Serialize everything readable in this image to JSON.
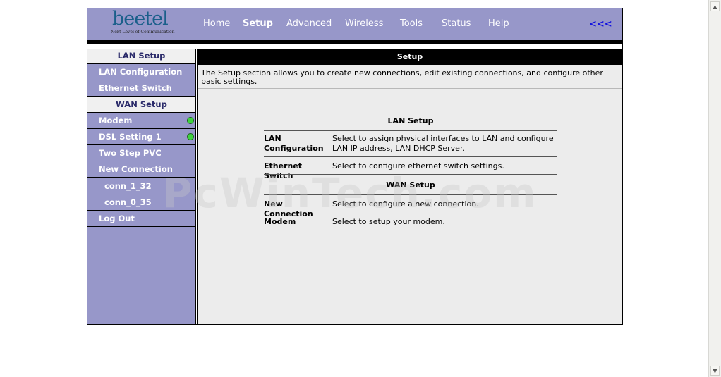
{
  "logo": {
    "name": "beetel",
    "tagline": "Next Level of Communication"
  },
  "nav": {
    "items": [
      {
        "label": "Home",
        "active": false
      },
      {
        "label": "Setup",
        "active": true
      },
      {
        "label": "Advanced",
        "active": false
      },
      {
        "label": "Wireless",
        "active": false
      },
      {
        "label": "Tools",
        "active": false
      },
      {
        "label": "Status",
        "active": false
      },
      {
        "label": "Help",
        "active": false
      }
    ],
    "back_label": "<<<"
  },
  "sidebar": {
    "lan_header": "LAN Setup",
    "lan_configuration": "LAN Configuration",
    "ethernet_switch": "Ethernet Switch",
    "wan_header": "WAN Setup",
    "modem": "Modem",
    "dsl_setting": "DSL Setting 1",
    "two_step_pvc": "Two Step PVC",
    "new_connection": "New Connection",
    "conn_1": "conn_1_32",
    "conn_2": "conn_0_35",
    "log_out": "Log Out",
    "status_color": "#3ed13e"
  },
  "main": {
    "title": "Setup",
    "intro": "The Setup section allows you to create new connections, edit existing connections, and configure other basic settings.",
    "lan_section": "LAN Setup",
    "wan_section": "WAN Setup",
    "rows": {
      "lan_config_label": "LAN Configuration",
      "lan_config_desc": "Select to assign physical interfaces to LAN and configure LAN IP address, LAN DHCP Server.",
      "eth_switch_label": "Ethernet Switch",
      "eth_switch_desc": "Select to configure ethernet switch settings.",
      "new_conn_label": "New Connection",
      "new_conn_desc": "Select to configure a new connection.",
      "modem_label": "Modem",
      "modem_desc": "Select to setup your modem."
    }
  },
  "watermark": "PcWinTech.com",
  "colors": {
    "header_bg": "#9797c9",
    "panel_bg": "#ececec"
  }
}
